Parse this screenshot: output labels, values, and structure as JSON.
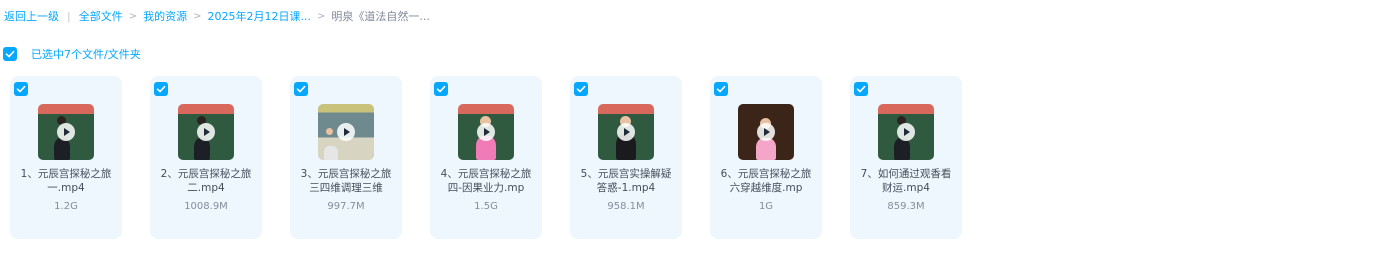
{
  "breadcrumb": {
    "back": "返回上一级",
    "items": [
      "全部文件",
      "我的资源",
      "2025年2月12日课..."
    ],
    "current": "明泉《道法自然一..."
  },
  "selection": {
    "text": "已选中7个文件/文件夹",
    "checked": true
  },
  "files": [
    {
      "name": "1、元辰宫探秘之旅一.mp4",
      "size": "1.2G",
      "thumb": "chalkboard-man",
      "checked": true
    },
    {
      "name": "2、元辰宫探秘之旅二.mp4",
      "size": "1008.9M",
      "thumb": "chalkboard-man",
      "checked": true
    },
    {
      "name": "3、元辰宫探秘之旅三四维调理三维",
      "size": "997.7M",
      "thumb": "classroom-screen",
      "checked": true
    },
    {
      "name": "4、元辰宫探秘之旅四-因果业力.mp",
      "size": "1.5G",
      "thumb": "woman-pink",
      "checked": true
    },
    {
      "name": "5、元辰宫实操解疑答惑-1.mp4",
      "size": "958.1M",
      "thumb": "man-dark",
      "checked": true
    },
    {
      "name": "6、元辰宫探秘之旅六穿越维度.mp",
      "size": "1G",
      "thumb": "woman-pink-dark",
      "checked": true
    },
    {
      "name": "7、如何通过观香看财运.mp4",
      "size": "859.3M",
      "thumb": "chalkboard-man",
      "checked": true
    }
  ],
  "colors": {
    "accent": "#06a7ff",
    "card_bg": "#eef7fe",
    "text": "#454d5a",
    "muted": "#878c9c",
    "chalkboard": "#2f5a40",
    "thumb_top": "#d9685c"
  }
}
